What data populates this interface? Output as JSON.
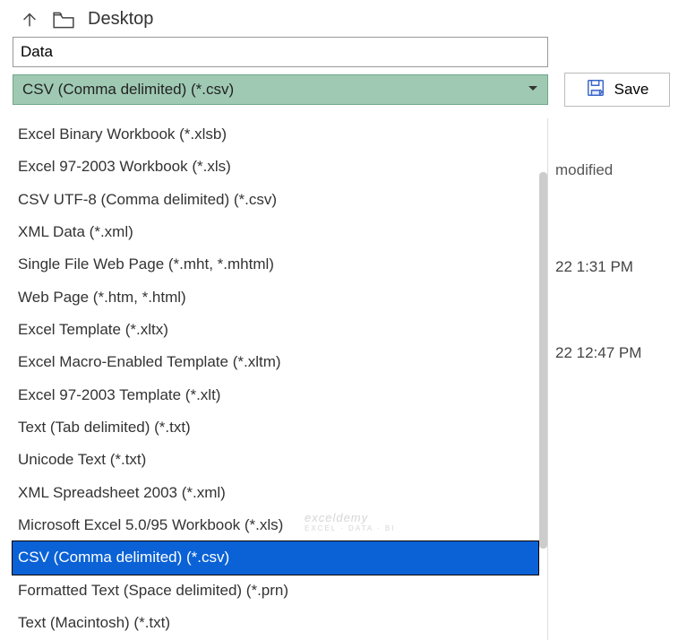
{
  "breadcrumb": {
    "location": "Desktop"
  },
  "filename": {
    "value": "Data"
  },
  "filetype": {
    "selected": "CSV (Comma delimited) (*.csv)"
  },
  "save": {
    "label": "Save"
  },
  "dropdown": {
    "items": [
      "Excel Binary Workbook (*.xlsb)",
      "Excel 97-2003 Workbook (*.xls)",
      "CSV UTF-8 (Comma delimited) (*.csv)",
      "XML Data (*.xml)",
      "Single File Web Page (*.mht, *.mhtml)",
      "Web Page (*.htm, *.html)",
      "Excel Template (*.xltx)",
      "Excel Macro-Enabled Template (*.xltm)",
      "Excel 97-2003 Template (*.xlt)",
      "Text (Tab delimited) (*.txt)",
      "Unicode Text (*.txt)",
      "XML Spreadsheet 2003 (*.xml)",
      "Microsoft Excel 5.0/95 Workbook (*.xls)",
      "CSV (Comma delimited) (*.csv)",
      "Formatted Text (Space delimited) (*.prn)",
      "Text (Macintosh) (*.txt)"
    ],
    "highlighted_index": 13
  },
  "background": {
    "column_header": "modified",
    "rows": [
      "22 1:31 PM",
      "22 12:47 PM"
    ]
  },
  "watermark": {
    "text": "exceldemy",
    "sub": "EXCEL · DATA · BI"
  }
}
